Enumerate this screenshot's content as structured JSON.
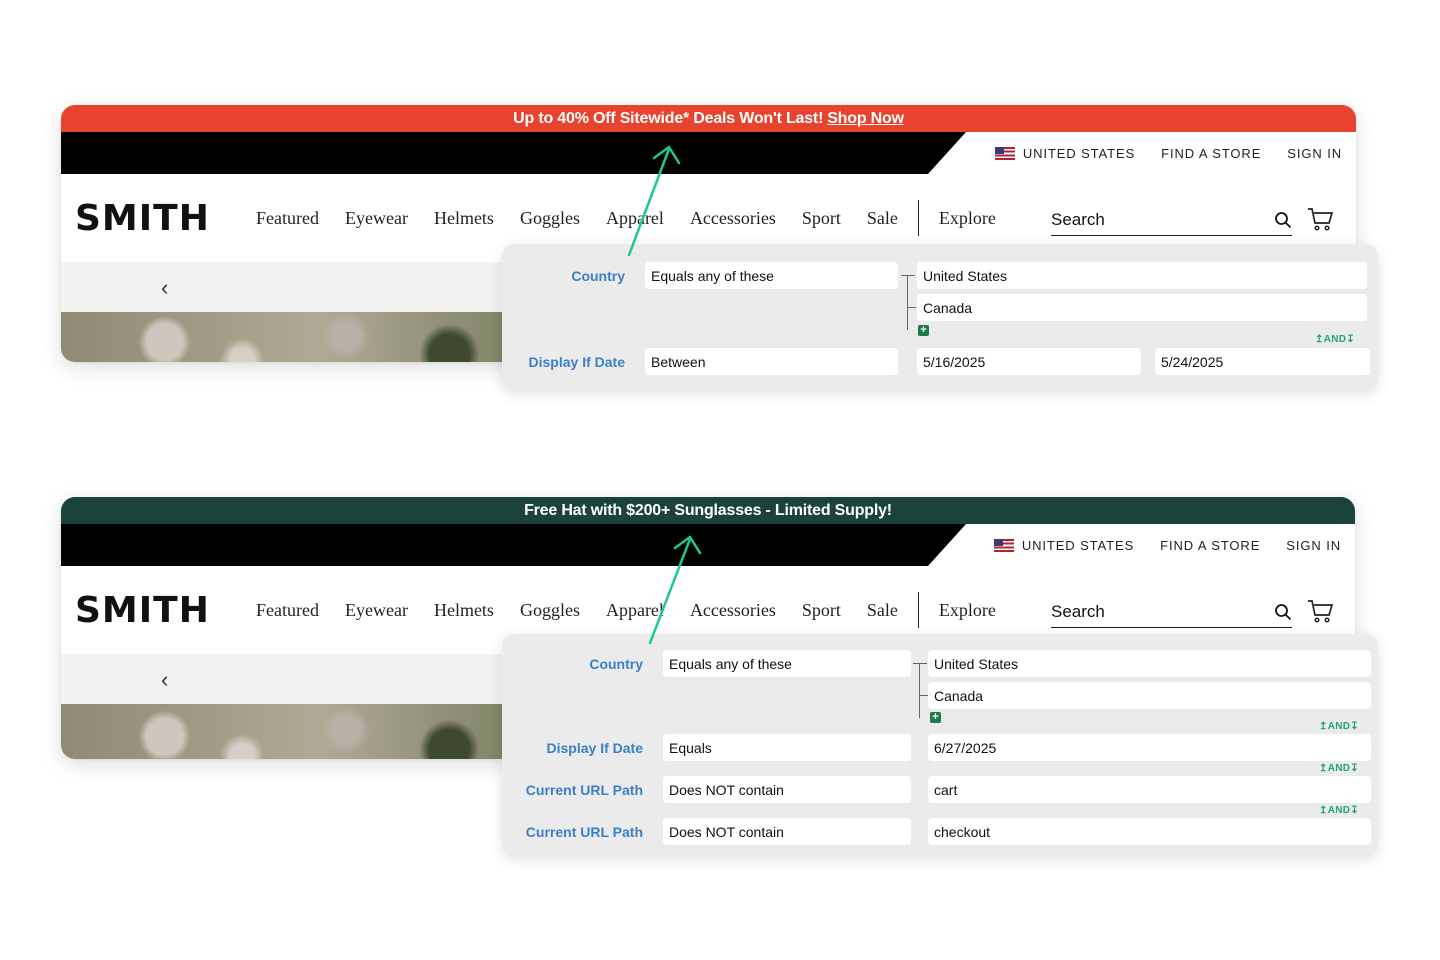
{
  "brand": {
    "logo_text": "SMITH"
  },
  "utility_links": {
    "country": "UNITED STATES",
    "find_store": "FIND A STORE",
    "sign_in": "SIGN IN"
  },
  "nav": [
    "Featured",
    "Eyewear",
    "Helmets",
    "Goggles",
    "Apparel",
    "Accessories",
    "Sport",
    "Sale"
  ],
  "explore_label": "Explore",
  "search_placeholder": "Search",
  "colors": {
    "promo_red": "#e8432f",
    "promo_green": "#1c423c",
    "label_blue": "#3b7fc7",
    "arrow_green": "#1ec98f"
  },
  "icons": [
    "search-icon",
    "cart-icon",
    "chevron-left-icon",
    "us-flag-icon",
    "add-icon"
  ],
  "example1": {
    "promo_text": "Up to 40% Off Sitewide* Deals Won't Last!",
    "promo_link": "Shop Now",
    "rules": {
      "country_label": "Country",
      "country_op": "Equals any of these",
      "country_values": [
        "United States",
        "Canada"
      ],
      "and_label": "AND",
      "date_label": "Display If Date",
      "date_op": "Between",
      "date_start": "5/16/2025",
      "date_end": "5/24/2025"
    }
  },
  "example2": {
    "promo_text": "Free Hat with $200+ Sunglasses - Limited Supply!",
    "rules": {
      "country_label": "Country",
      "country_op": "Equals any of these",
      "country_values": [
        "United States",
        "Canada"
      ],
      "and_label": "AND",
      "date_label": "Display If Date",
      "date_op": "Equals",
      "date_value": "6/27/2025",
      "url_label_1": "Current URL Path",
      "url_op_1": "Does NOT contain",
      "url_value_1": "cart",
      "url_label_2": "Current URL Path",
      "url_op_2": "Does NOT contain",
      "url_value_2": "checkout"
    }
  }
}
